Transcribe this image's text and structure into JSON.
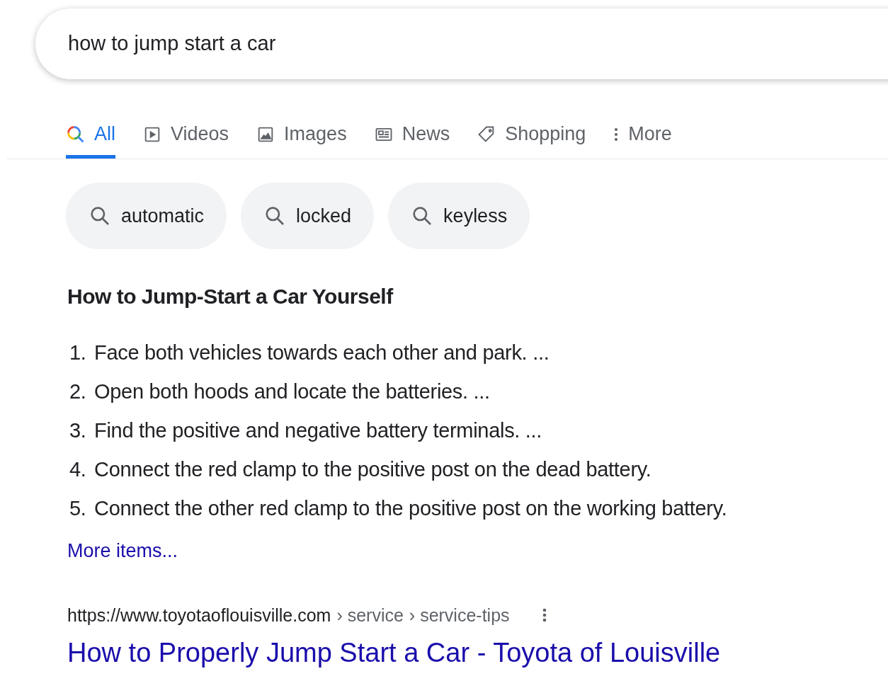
{
  "search": {
    "value": "how to jump start a car"
  },
  "tabs": [
    {
      "label": "All",
      "selected": true
    },
    {
      "label": "Videos",
      "selected": false
    },
    {
      "label": "Images",
      "selected": false
    },
    {
      "label": "News",
      "selected": false
    },
    {
      "label": "Shopping",
      "selected": false
    },
    {
      "label": "More",
      "selected": false
    }
  ],
  "chips": [
    "automatic",
    "locked",
    "keyless"
  ],
  "featured": {
    "title": "How to Jump-Start a Car Yourself",
    "steps": [
      {
        "number": "1.",
        "text": "Face both vehicles towards each other and park. ..."
      },
      {
        "number": "2.",
        "text": "Open both hoods and locate the batteries. ..."
      },
      {
        "number": "3.",
        "text": "Find the positive and negative battery terminals. ..."
      },
      {
        "number": "4.",
        "text": "Connect the red clamp to the positive post on the dead battery."
      },
      {
        "number": "5.",
        "text": "Connect the other red clamp to the positive post on the working battery."
      }
    ],
    "more_link": "More items..."
  },
  "result": {
    "url": "https://www.toyotaoflouisville.com",
    "breadcrumbs": [
      "› service",
      "› service-tips"
    ],
    "title": "How to Properly Jump Start a Car - Toyota of Louisville"
  }
}
